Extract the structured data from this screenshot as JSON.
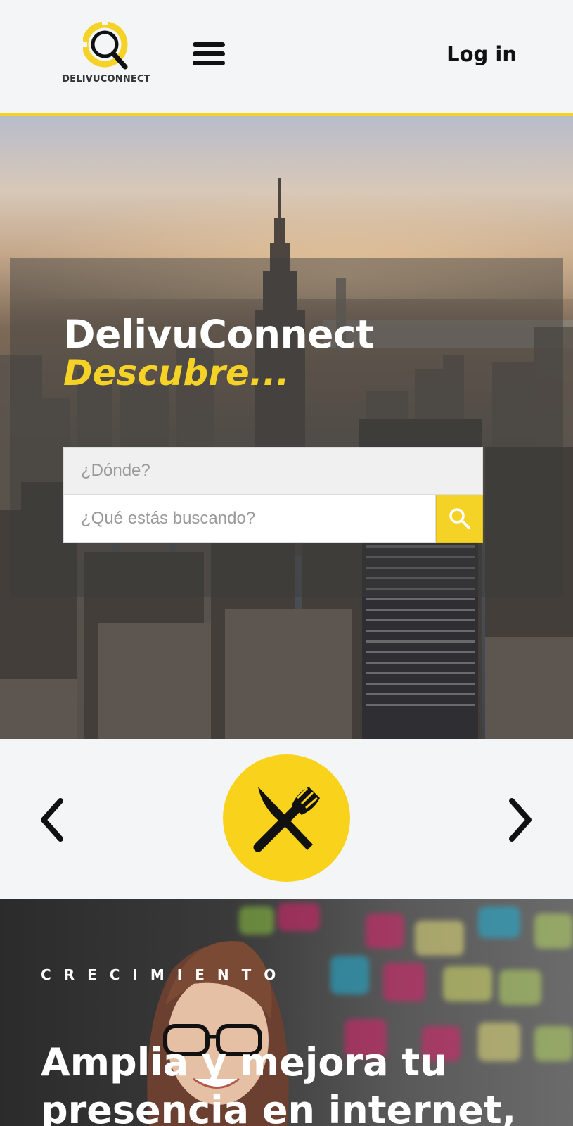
{
  "header": {
    "logo_text": "DELIVUCONNECT",
    "login_label": "Log in"
  },
  "hero": {
    "title": "DelivuConnect",
    "subtitle": "Descubre...",
    "where_placeholder": "¿Dónde?",
    "what_placeholder": "¿Qué estás buscando?"
  },
  "carousel": {
    "current_category_icon": "fork-knife-icon"
  },
  "growth": {
    "kicker": "CRECIMIENTO",
    "title": "Amplia y mejora tu presencia en internet,"
  },
  "colors": {
    "accent": "#f5d226",
    "background": "#f4f5f7",
    "text_dark": "#111111"
  }
}
